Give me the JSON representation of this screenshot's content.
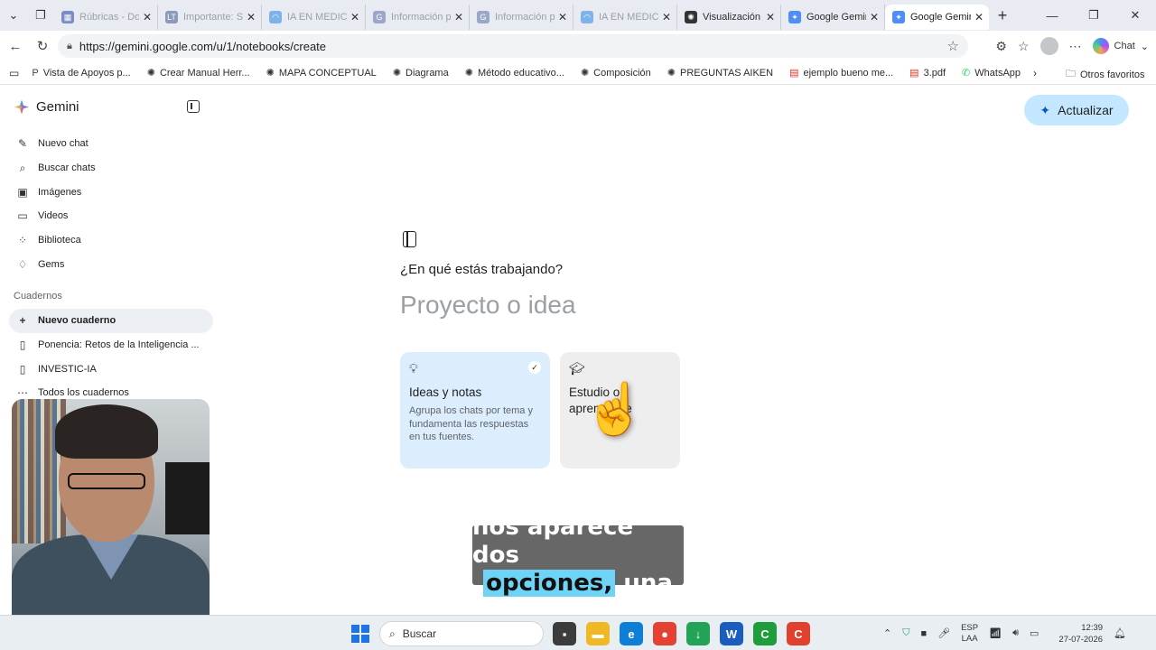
{
  "browser": {
    "tabs": [
      {
        "label": "Rúbricas - Doc",
        "icon": "docs-flag-icon",
        "active": false
      },
      {
        "label": "Importante: Se",
        "icon": "lt-icon",
        "active": false
      },
      {
        "label": "IA EN MEDICIN",
        "icon": "rainbow-icon",
        "active": false
      },
      {
        "label": "Información pe",
        "icon": "google-icon",
        "active": false
      },
      {
        "label": "Información pe",
        "icon": "google-icon",
        "active": false
      },
      {
        "label": "IA EN MEDICIN",
        "icon": "rainbow-icon",
        "active": false
      },
      {
        "label": "Visualización fo",
        "icon": "openai-icon",
        "active": false
      },
      {
        "label": "Google Gemini",
        "icon": "gemini-icon",
        "active": false
      },
      {
        "label": "Google Gemini",
        "icon": "gemini-icon",
        "active": true
      }
    ],
    "url": "https://gemini.google.com/u/1/notebooks/create",
    "copilot_label": "Chat",
    "favorites": [
      {
        "label": "Vista de Apoyos p...",
        "icon": "pkp-icon"
      },
      {
        "label": "Crear Manual Herr...",
        "icon": "openai-icon"
      },
      {
        "label": "MAPA CONCEPTUAL",
        "icon": "openai-icon"
      },
      {
        "label": "Diagrama",
        "icon": "openai-icon"
      },
      {
        "label": "Método educativo...",
        "icon": "openai-icon"
      },
      {
        "label": "Composición",
        "icon": "openai-icon"
      },
      {
        "label": "PREGUNTAS AIKEN",
        "icon": "openai-icon"
      },
      {
        "label": "ejemplo bueno me...",
        "icon": "pdf-icon"
      },
      {
        "label": "3.pdf",
        "icon": "pdf-icon"
      },
      {
        "label": "WhatsApp",
        "icon": "whatsapp-icon"
      }
    ],
    "favorites_other": "Otros favoritos"
  },
  "sidebar": {
    "brand": "Gemini",
    "items": [
      {
        "label": "Nuevo chat",
        "icon": "edit-icon"
      },
      {
        "label": "Buscar chats",
        "icon": "search-icon"
      },
      {
        "label": "Imágenes",
        "icon": "image-icon"
      },
      {
        "label": "Videos",
        "icon": "video-icon"
      },
      {
        "label": "Biblioteca",
        "icon": "library-icon"
      },
      {
        "label": "Gems",
        "icon": "gem-icon"
      }
    ],
    "section_title": "Cuadernos",
    "notebooks": [
      {
        "label": "Nuevo cuaderno",
        "icon": "plus-icon",
        "selected": true
      },
      {
        "label": "Ponencia: Retos de la Inteligencia ...",
        "icon": "notebook-icon",
        "selected": false
      },
      {
        "label": "INVESTIC-IA",
        "icon": "notebook-icon",
        "selected": false
      },
      {
        "label": "Todos los cuadernos",
        "icon": "more-icon",
        "selected": false
      }
    ]
  },
  "main": {
    "update_button": "Actualizar",
    "question": "¿En qué estás trabajando?",
    "input_placeholder": "Proyecto o idea",
    "cards": [
      {
        "title": "Ideas y notas",
        "description": "Agrupa los chats por tema y fundamenta las respuestas en tus fuentes.",
        "icon": "lightbulb-icon",
        "selected": true
      },
      {
        "title": "Estudio o aprendizaje",
        "icon": "graduation-cap-icon",
        "selected": false
      }
    ]
  },
  "caption": {
    "line1": "nos aparece dos",
    "highlight": "opciones,",
    "line2_rest": "una"
  },
  "taskbar": {
    "search_label": "Buscar",
    "lang": "ESP",
    "layout": "LAA",
    "time": "12:39",
    "date": "27-07-2026"
  }
}
